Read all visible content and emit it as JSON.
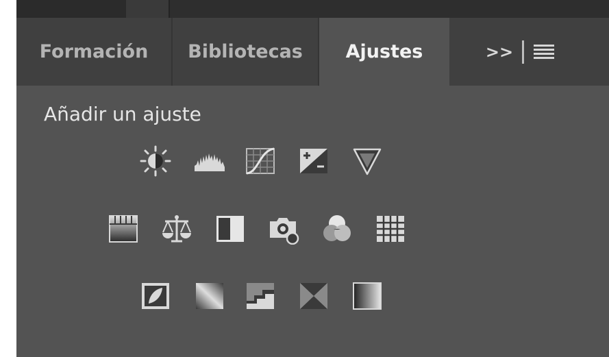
{
  "tabs": [
    {
      "label": "Formación"
    },
    {
      "label": "Bibliotecas"
    },
    {
      "label": "Ajustes"
    }
  ],
  "more_tabs_label": ">>",
  "heading": "Añadir un ajuste",
  "adjustment_icons": [
    [
      "brightness-contrast-icon",
      "levels-icon",
      "curves-icon",
      "exposure-icon",
      "vibrance-icon"
    ],
    [
      "hue-saturation-icon",
      "color-balance-icon",
      "black-white-icon",
      "photo-filter-icon",
      "channel-mixer-icon",
      "color-lookup-icon"
    ],
    [
      "invert-icon",
      "posterize-icon",
      "threshold-icon",
      "selective-color-icon",
      "gradient-map-icon"
    ]
  ],
  "colors": {
    "panel_bg": "#535353",
    "tabbar_bg": "#404040",
    "active_tab_text": "#f2f2f2",
    "inactive_tab_text": "#b4b4b4",
    "icon_color": "#d9d9d9"
  }
}
